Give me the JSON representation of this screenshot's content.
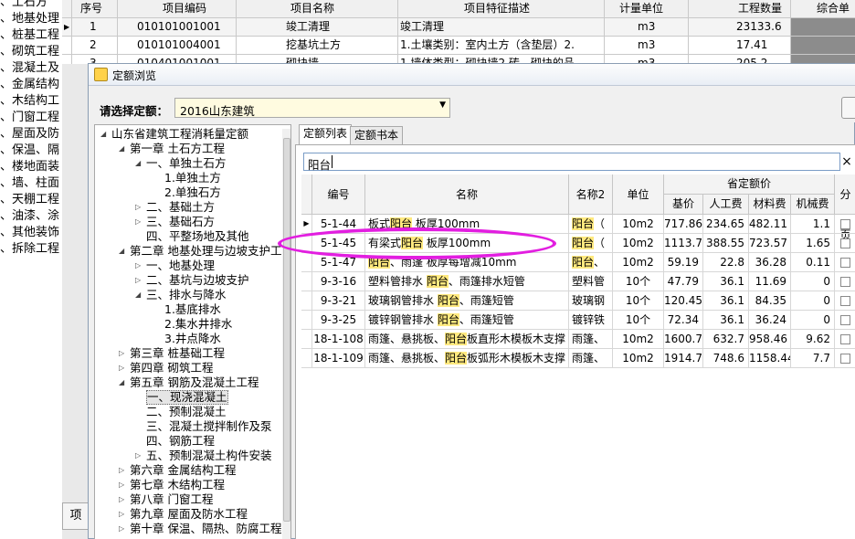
{
  "left_list": [
    "、土石方",
    "、地基处理",
    "、桩基工程",
    "、砌筑工程",
    "、混凝土及",
    "、金属结构",
    "、木结构工",
    "、门窗工程",
    "、屋面及防",
    "、保温、隔",
    "、楼地面装",
    "、墙、柱面",
    "、天棚工程",
    "、油漆、涂",
    "、其他装饰",
    "、拆除工程"
  ],
  "bg_table": {
    "headers": [
      "序号",
      "项目编码",
      "项目名称",
      "项目特征描述",
      "计量单位",
      "工程数量",
      "综合单"
    ],
    "rows": [
      {
        "no": "1",
        "code": "010101001001",
        "name": "竣工清理",
        "desc": "竣工清理",
        "unit": "m3",
        "qty": "23133.6"
      },
      {
        "no": "2",
        "code": "010101004001",
        "name": "挖基坑土方",
        "desc": "1.土壤类别：室内土方（含垫层）2.",
        "unit": "m3",
        "qty": "17.41"
      },
      {
        "no": "3",
        "code": "010401001001",
        "name": "砌块墙",
        "desc": "1.墙体类型：砌块墙2.砖、砌块的品",
        "unit": "m3",
        "qty": "205.2"
      }
    ],
    "row4_fragment": "1.墙体类型：砌块..."
  },
  "left_bottom_label": "项",
  "dialog": {
    "title": "定额浏览",
    "select_label": "请选择定额：",
    "select_value": "2016山东建筑",
    "tabs": [
      "定额列表",
      "定额书本"
    ],
    "search_value": "阳台",
    "search_close": "×"
  },
  "tree": [
    {
      "label": "山东省建筑工程消耗量定额",
      "level": 0,
      "arrow": "◢"
    },
    {
      "label": "第一章 土石方工程",
      "level": 1,
      "arrow": "◢"
    },
    {
      "label": "一、单独土石方",
      "level": 2,
      "arrow": "◢"
    },
    {
      "label": "1.单独土方",
      "level": 3,
      "arrow": ""
    },
    {
      "label": "2.单独石方",
      "level": 3,
      "arrow": ""
    },
    {
      "label": "二、基础土方",
      "level": 2,
      "arrow": "▷"
    },
    {
      "label": "三、基础石方",
      "level": 2,
      "arrow": "▷"
    },
    {
      "label": "四、平整场地及其他",
      "level": 2,
      "arrow": ""
    },
    {
      "label": "第二章 地基处理与边坡支护工",
      "level": 1,
      "arrow": "◢"
    },
    {
      "label": "一、地基处理",
      "level": 2,
      "arrow": "▷"
    },
    {
      "label": "二、基坑与边坡支护",
      "level": 2,
      "arrow": "▷"
    },
    {
      "label": "三、排水与降水",
      "level": 2,
      "arrow": "◢"
    },
    {
      "label": "1.基底排水",
      "level": 3,
      "arrow": ""
    },
    {
      "label": "2.集水井排水",
      "level": 3,
      "arrow": ""
    },
    {
      "label": "3.井点降水",
      "level": 3,
      "arrow": ""
    },
    {
      "label": "第三章 桩基础工程",
      "level": 1,
      "arrow": "▷"
    },
    {
      "label": "第四章 砌筑工程",
      "level": 1,
      "arrow": "▷"
    },
    {
      "label": "第五章 钢筋及混凝土工程",
      "level": 1,
      "arrow": "◢"
    },
    {
      "label": "一、现浇混凝土",
      "level": 2,
      "arrow": "",
      "selected": true
    },
    {
      "label": "二、预制混凝土",
      "level": 2,
      "arrow": ""
    },
    {
      "label": "三、混凝土搅拌制作及泵",
      "level": 2,
      "arrow": ""
    },
    {
      "label": "四、钢筋工程",
      "level": 2,
      "arrow": ""
    },
    {
      "label": "五、预制混凝土构件安装",
      "level": 2,
      "arrow": "▷"
    },
    {
      "label": "第六章 金属结构工程",
      "level": 1,
      "arrow": "▷"
    },
    {
      "label": "第七章 木结构工程",
      "level": 1,
      "arrow": "▷"
    },
    {
      "label": "第八章 门窗工程",
      "level": 1,
      "arrow": "▷"
    },
    {
      "label": "第九章 屋面及防水工程",
      "level": 1,
      "arrow": "▷"
    },
    {
      "label": "第十章 保温、隔热、防腐工程",
      "level": 1,
      "arrow": "▷"
    }
  ],
  "grid": {
    "headers": {
      "code": "编号",
      "name": "名称",
      "name2": "名称2",
      "unit": "单位",
      "group": "省定额价",
      "base": "基价",
      "labor": "人工费",
      "material": "材料费",
      "machine": "机械费",
      "split": "分页"
    },
    "rows": [
      {
        "code": "5-1-44",
        "name_pre": "板式",
        "name_hl": "阳台",
        "name_post": " 板厚100mm",
        "name2_hl": "阳台",
        "name2_post": "（",
        "unit": "10m2",
        "base": "717.86",
        "labor": "234.65",
        "material": "482.11",
        "machine": "1.1",
        "current": true
      },
      {
        "code": "5-1-45",
        "name_pre": "有梁式",
        "name_hl": "阳台",
        "name_post": " 板厚100mm",
        "name2_hl": "阳台",
        "name2_post": "（",
        "unit": "10m2",
        "base": "1113.77",
        "labor": "388.55",
        "material": "723.57",
        "machine": "1.65"
      },
      {
        "code": "5-1-47",
        "name_pre": "",
        "name_hl": "阳台",
        "name_post": "、雨篷 板厚每增减10mm",
        "name2_hl": "阳台",
        "name2_post": "、",
        "unit": "10m2",
        "base": "59.19",
        "labor": "22.8",
        "material": "36.28",
        "machine": "0.11"
      },
      {
        "code": "9-3-16",
        "name_pre": "塑料管排水 ",
        "name_hl": "阳台",
        "name_post": "、雨篷排水短管",
        "name2_hl": "",
        "name2_post": "塑料管",
        "unit": "10个",
        "base": "47.79",
        "labor": "36.1",
        "material": "11.69",
        "machine": "0"
      },
      {
        "code": "9-3-21",
        "name_pre": "玻璃钢管排水 ",
        "name_hl": "阳台",
        "name_post": "、雨篷短管",
        "name2_hl": "",
        "name2_post": "玻璃钢",
        "unit": "10个",
        "base": "120.45",
        "labor": "36.1",
        "material": "84.35",
        "machine": "0"
      },
      {
        "code": "9-3-25",
        "name_pre": "镀锌钢管排水 ",
        "name_hl": "阳台",
        "name_post": "、雨篷短管",
        "name2_hl": "",
        "name2_post": "镀锌铁",
        "unit": "10个",
        "base": "72.34",
        "labor": "36.1",
        "material": "36.24",
        "machine": "0"
      },
      {
        "code": "18-1-108",
        "name_pre": "雨篷、悬挑板、",
        "name_hl": "阳台",
        "name_post": "板直形木模板木支撑",
        "name2_hl": "",
        "name2_post": "雨篷、",
        "unit": "10m2",
        "base": "1600.78",
        "labor": "632.7",
        "material": "958.46",
        "machine": "9.62"
      },
      {
        "code": "18-1-109",
        "name_pre": "雨篷、悬挑板、",
        "name_hl": "阳台",
        "name_post": "板弧形木模板木支撑",
        "name2_hl": "",
        "name2_post": "雨篷、",
        "unit": "10m2",
        "base": "1914.74",
        "labor": "748.6",
        "material": "1158.44",
        "machine": "7.7"
      }
    ]
  },
  "colors": {
    "highlight": "#ffe97f",
    "annotation": "#e21ee0"
  }
}
